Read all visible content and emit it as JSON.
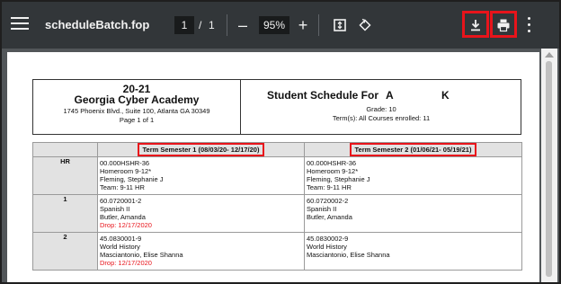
{
  "toolbar": {
    "title": "scheduleBatch.fop",
    "current_page": "1",
    "page_separator": "/",
    "total_pages": "1",
    "zoom": "95%",
    "zoom_out_label": "–",
    "zoom_in_label": "+",
    "highlight_color": "#e8141b"
  },
  "header": {
    "school_year": "20-21",
    "school_name": "Georgia Cyber Academy",
    "address": "1745 Phoenix Blvd., Suite 100, Atlanta  GA 30349",
    "page_info": "Page 1 of  1",
    "title": "Student Schedule For",
    "student_first": "A",
    "student_last": "K",
    "grade": "Grade: 10",
    "terms": "Term(s): All Courses enrolled: 11"
  },
  "table": {
    "term1": "Term Semester 1 (08/03/20- 12/17/20)",
    "term2": "Term Semester 2 (01/06/21- 05/19/21)",
    "rows": [
      {
        "period": "HR",
        "s1": [
          "00.000HSHR-36",
          "Homeroom 9-12*",
          "Fleming, Stephanie J",
          "Team: 9-11 HR"
        ],
        "s1_drop": "",
        "s2": [
          "00.000HSHR-36",
          "Homeroom 9-12*",
          "Fleming, Stephanie J",
          "Team: 9-11 HR"
        ]
      },
      {
        "period": "1",
        "s1": [
          "60.0720001-2",
          "Spanish II",
          "Butler, Amanda"
        ],
        "s1_drop": "Drop: 12/17/2020",
        "s2": [
          "60.0720002-2",
          "Spanish II",
          "Butler, Amanda"
        ]
      },
      {
        "period": "2",
        "s1": [
          "45.0830001-9",
          "World History",
          "Masciantonio, Elise Shanna"
        ],
        "s1_drop": "Drop: 12/17/2020",
        "s2": [
          "45.0830002-9",
          "World History",
          "Masciantonio, Elise Shanna"
        ]
      }
    ]
  }
}
